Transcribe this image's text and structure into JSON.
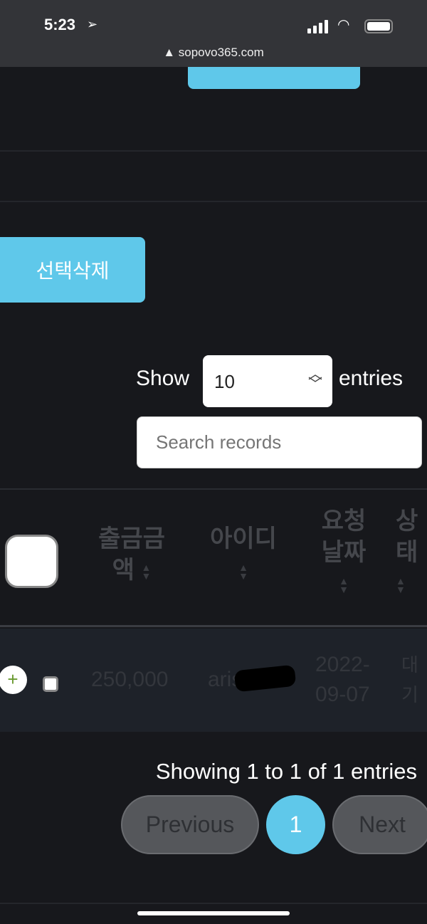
{
  "status_bar": {
    "time": "5:23",
    "url": "sopovo365.com"
  },
  "actions": {
    "delete_selected": "선택삭제"
  },
  "length": {
    "show": "Show",
    "value": "10",
    "entries": "entries"
  },
  "search": {
    "placeholder": "Search records"
  },
  "table": {
    "headers": [
      {
        "line1": "출금금",
        "line2": "액"
      },
      {
        "line1": "아이디",
        "line2": ""
      },
      {
        "line1": "요청",
        "line2": "날짜"
      },
      {
        "line1": "상",
        "line2": "태"
      }
    ],
    "rows": [
      {
        "amount": "250,000",
        "id": "aris",
        "date1": "2022-",
        "date2": "09-07",
        "status1": "대",
        "status2": "기"
      }
    ]
  },
  "pagination": {
    "info": "Showing 1 to 1 of 1 entries",
    "previous": "Previous",
    "current": "1",
    "next": "Next"
  },
  "colors": {
    "accent": "#5fc8ea",
    "background": "#17181c"
  }
}
